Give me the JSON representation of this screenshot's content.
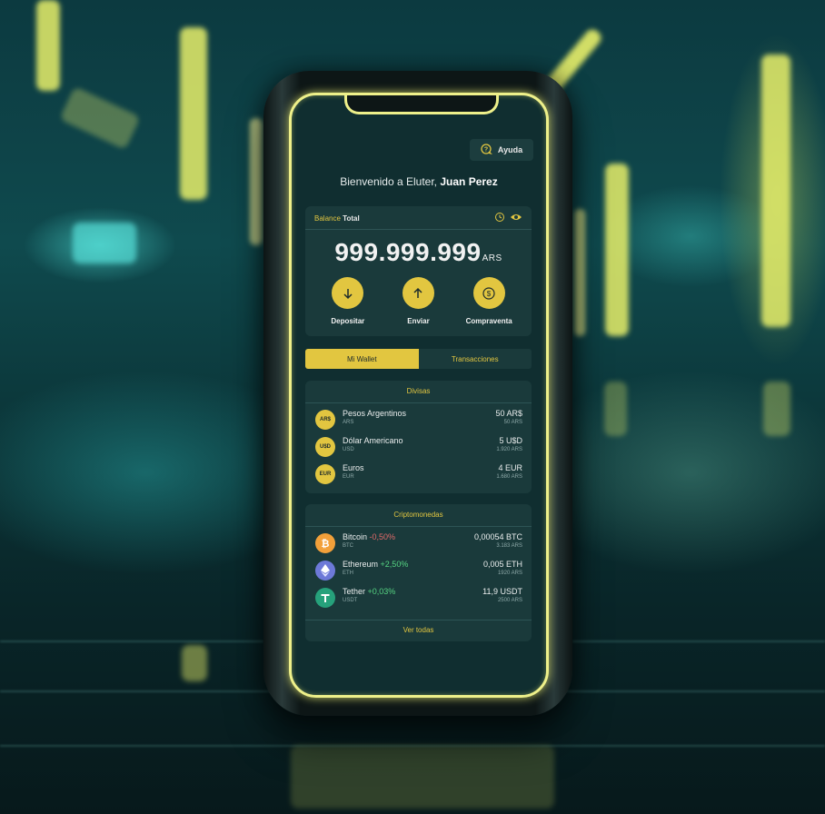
{
  "header": {
    "help_label": "Ayuda"
  },
  "welcome": {
    "prefix": "Bienvenido a Eluter,",
    "name": "Juan Perez"
  },
  "balance": {
    "label_prefix": "Balance",
    "label_strong": "Total",
    "amount": "999.999.999",
    "currency": "ARS"
  },
  "actions": [
    {
      "label": "Depositar",
      "icon": "arrow-down-icon"
    },
    {
      "label": "Enviar",
      "icon": "arrow-up-icon"
    },
    {
      "label": "Compraventa",
      "icon": "coin-icon"
    }
  ],
  "tabs": [
    {
      "label": "Mi Wallet",
      "active": true
    },
    {
      "label": "Transacciones",
      "active": false
    }
  ],
  "divisas": {
    "title": "Divisas",
    "items": [
      {
        "symbol": "AR$",
        "name": "Pesos Argentinos",
        "code": "ARS",
        "amount": "50 AR$",
        "converted": "50 ARS"
      },
      {
        "symbol": "U$D",
        "name": "Dólar Americano",
        "code": "USD",
        "amount": "5 U$D",
        "converted": "1.920 ARS"
      },
      {
        "symbol": "EUR",
        "name": "Euros",
        "code": "EUR",
        "amount": "4 EUR",
        "converted": "1.680 ARS"
      }
    ]
  },
  "crypto": {
    "title": "Criptomonedas",
    "items": [
      {
        "name": "Bitcoin",
        "change": "-0,50%",
        "code": "BTC",
        "amount": "0,00054 BTC",
        "converted": "3.183 ARS",
        "color": "#f2a03a"
      },
      {
        "name": "Ethereum",
        "change": "+2,50%",
        "code": "ETH",
        "amount": "0,005 ETH",
        "converted": "1920 ARS",
        "color": "#6d79d8"
      },
      {
        "name": "Tether",
        "change": "+0,03%",
        "code": "USDT",
        "amount": "11,9 USDT",
        "converted": "2500 ARS",
        "color": "#26a17b"
      }
    ],
    "see_all": "Ver todas"
  },
  "colors": {
    "accent": "#e2c640",
    "card": "#1a3a3b",
    "screen": "#102e30",
    "negative": "#e36a6a",
    "positive": "#56d482"
  }
}
